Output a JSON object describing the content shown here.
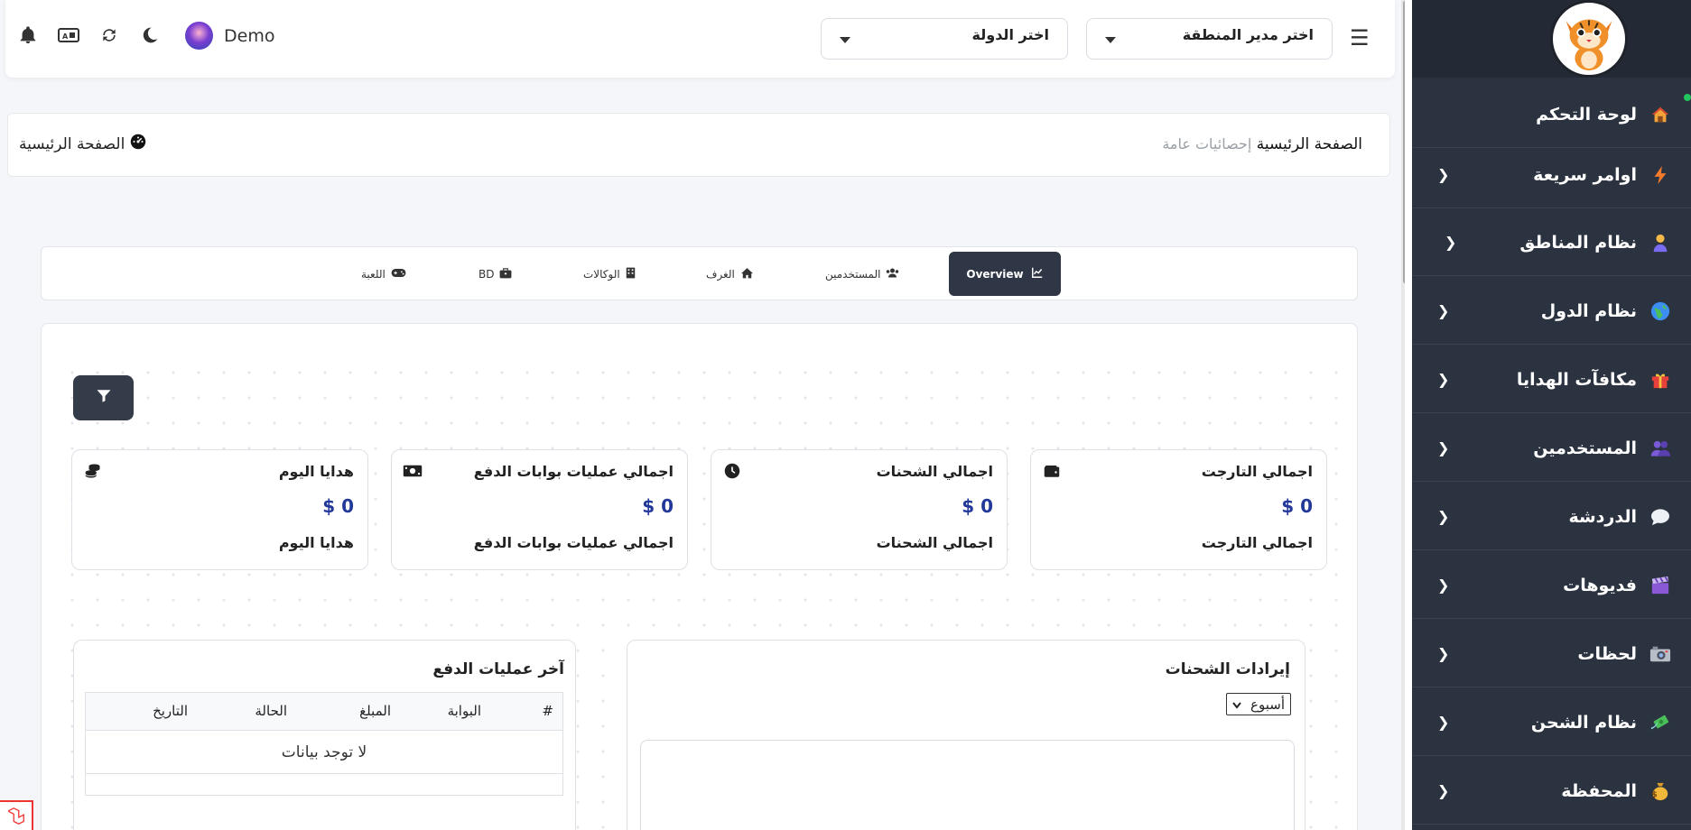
{
  "sidebar": {
    "items": [
      {
        "label": "لوحة التحكم",
        "icon": "house-icon",
        "has_chevron": false
      },
      {
        "label": "اوامر سريعة",
        "icon": "lightning-icon",
        "has_chevron": true
      },
      {
        "label": "نظام المناطق",
        "icon": "person-icon",
        "has_chevron": true
      },
      {
        "label": "نظام الدول",
        "icon": "globe-icon",
        "has_chevron": true
      },
      {
        "label": "مكافآت الهدايا",
        "icon": "gift-icon",
        "has_chevron": true
      },
      {
        "label": "المستخدمين",
        "icon": "users-icon",
        "has_chevron": true
      },
      {
        "label": "الدردشة",
        "icon": "chat-bubble-icon",
        "has_chevron": true
      },
      {
        "label": "فديوهات",
        "icon": "clapperboard-icon",
        "has_chevron": true
      },
      {
        "label": "لحظات",
        "icon": "camera-icon",
        "has_chevron": true
      },
      {
        "label": "نظام الشحن",
        "icon": "money-wings-icon",
        "has_chevron": true
      },
      {
        "label": "المحفظة",
        "icon": "money-bag-icon",
        "has_chevron": true
      }
    ]
  },
  "header": {
    "region_manager_select": "اختر مدير المنطقة",
    "country_select": "اختر الدولة",
    "user_name": "Demo"
  },
  "breadcrumb": {
    "home": "الصفحة الرئيسية",
    "current": "إحصائيات عامة",
    "left_title": "الصفحة الرئيسية"
  },
  "tabs": [
    {
      "label": "Overview",
      "icon": "chart-line-icon",
      "active": true
    },
    {
      "label": "المستخدمين",
      "icon": "users-icon",
      "active": false
    },
    {
      "label": "الغرف",
      "icon": "home-icon",
      "active": false
    },
    {
      "label": "الوكالات",
      "icon": "building-icon",
      "active": false
    },
    {
      "label": "BD",
      "icon": "briefcase-icon",
      "active": false
    },
    {
      "label": "اللعبة",
      "icon": "gamepad-icon",
      "active": false
    }
  ],
  "stats": [
    {
      "title": "اجمالي التارجت",
      "value": "$ 0",
      "subtitle": "اجمالي التارجت",
      "icon": "wallet-icon"
    },
    {
      "title": "اجمالي الشحنات",
      "value": "$ 0",
      "subtitle": "اجمالي الشحنات",
      "icon": "clock-icon"
    },
    {
      "title": "اجمالي عمليات بوابات الدفع",
      "value": "$ 0",
      "subtitle": "اجمالي عمليات بوابات الدفع",
      "icon": "money-bill-icon"
    },
    {
      "title": "هدايا اليوم",
      "value": "$ 0",
      "subtitle": "هدايا اليوم",
      "icon": "coins-icon"
    }
  ],
  "charge_revenue": {
    "title": "إيرادات الشحنات",
    "period_select": "أسبوع"
  },
  "payments": {
    "title": "آخر عمليات الدفع",
    "columns": [
      "#",
      "البوابة",
      "المبلغ",
      "الحالة",
      "التاريخ"
    ],
    "empty_text": "لا توجد بيانات"
  },
  "colors": {
    "sidebar_bg": "#2b3340",
    "active_tab_bg": "#2f3645",
    "stat_value": "#22399a"
  }
}
